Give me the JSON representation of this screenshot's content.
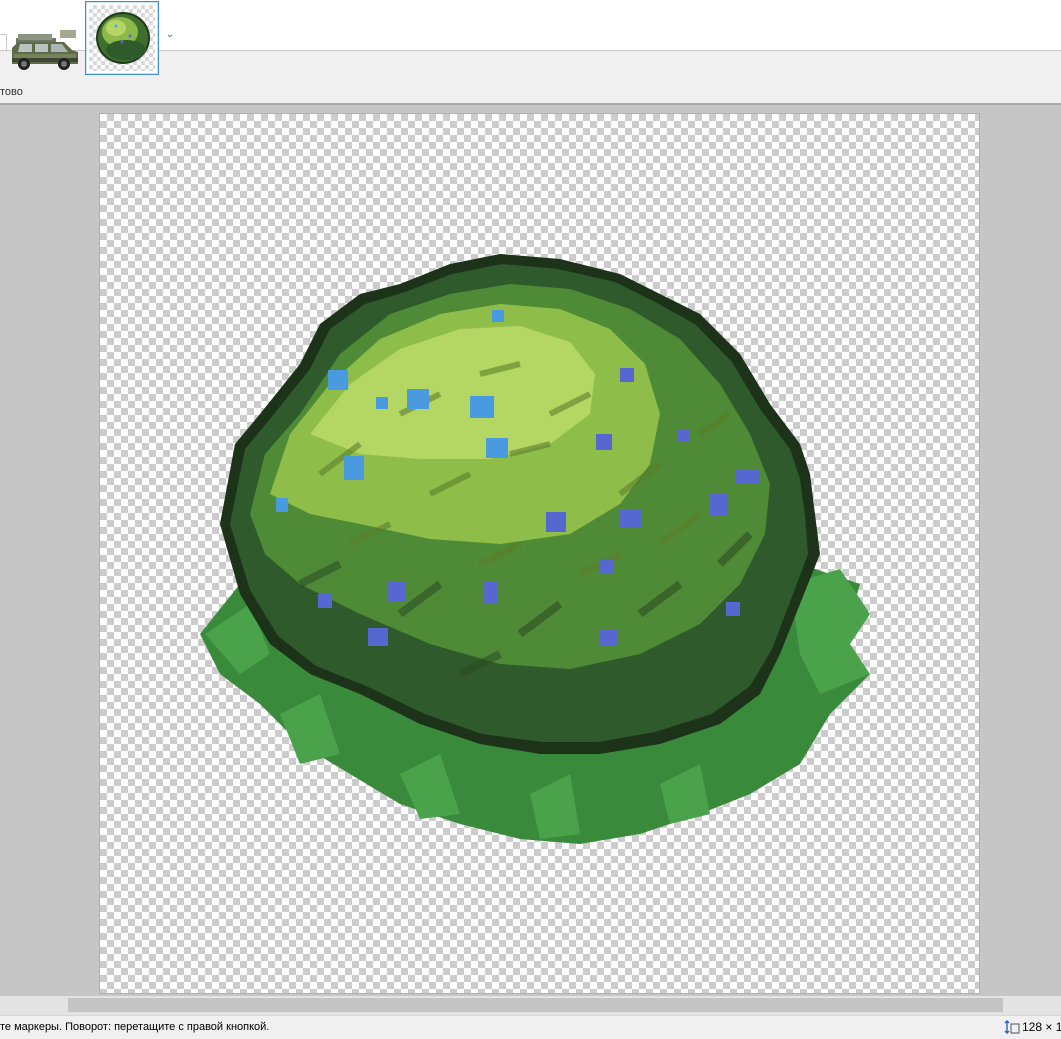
{
  "tabs": [
    {
      "name": "car-sprite",
      "selected": false
    },
    {
      "name": "bush-sprite",
      "selected": true
    }
  ],
  "toolbar": {
    "ready_text": "тово",
    "tab_dropdown_icon": "chevron-down-icon"
  },
  "status": {
    "hint": "те маркеры. Поворот: перетащите с правой кнопкой.",
    "image_size": "128 × 1",
    "size_icon": "image-size-icon"
  },
  "colors": {
    "accent": "#3c8fd6",
    "workarea": "#c6c6c6"
  }
}
